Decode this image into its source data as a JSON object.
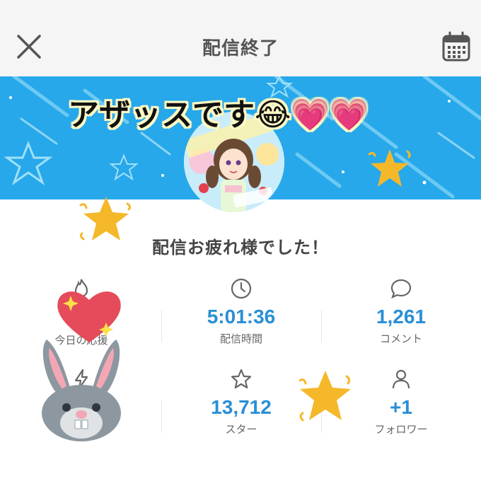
{
  "header": {
    "title": "配信終了"
  },
  "banner": {
    "caption": "アザッスです😂💗💗"
  },
  "main": {
    "message": "配信お疲れ様でした！"
  },
  "stats": [
    {
      "icon": "flame-icon",
      "value": "",
      "label": "今日の応援"
    },
    {
      "icon": "clock-icon",
      "value": "5:01:36",
      "label": "配信時間"
    },
    {
      "icon": "chat-bubble-icon",
      "value": "1,261",
      "label": "コメント"
    },
    {
      "icon": "lightning-icon",
      "value": "",
      "label": ""
    },
    {
      "icon": "star-outline-icon",
      "value": "13,712",
      "label": "スター"
    },
    {
      "icon": "person-icon",
      "value": "+1",
      "label": "フォロワー"
    }
  ],
  "colors": {
    "accent": "#2a8fd6",
    "banner": "#27a8ea",
    "star": "#f5b82a",
    "heart": "#e54b5a"
  }
}
